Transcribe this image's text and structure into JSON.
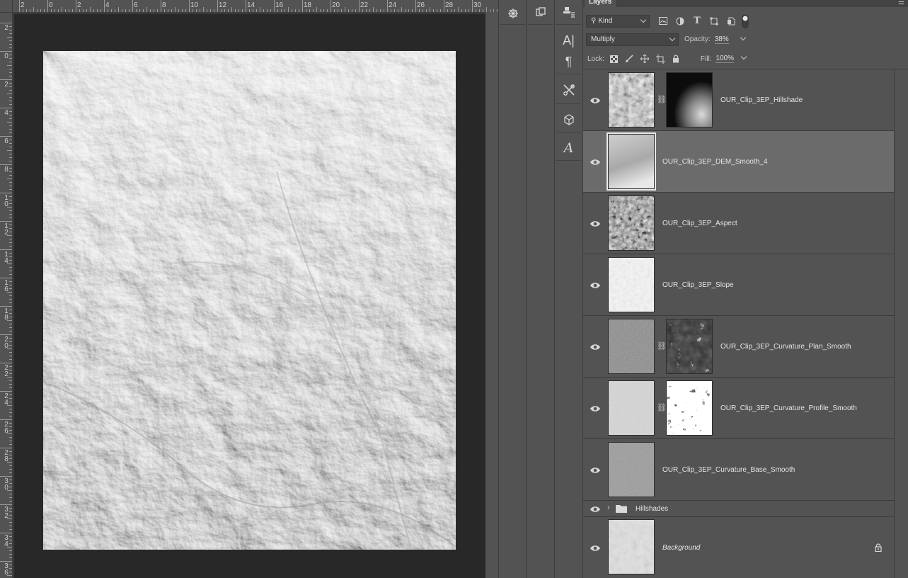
{
  "rulers": {
    "top_labels": [
      "2",
      "0",
      "2",
      "4",
      "6",
      "8",
      "10",
      "12",
      "14",
      "16",
      "18",
      "20",
      "22",
      "24",
      "26",
      "28",
      "30"
    ],
    "left_labels": [
      "2",
      "0",
      "2",
      "4",
      "6",
      "8",
      "10",
      "12",
      "14",
      "16",
      "18",
      "20",
      "22",
      "24",
      "26",
      "28",
      "30",
      "32",
      "34",
      "36"
    ]
  },
  "dock": {
    "strip_a_icons": [
      "navigator-wheel-icon"
    ],
    "strip_b_icons": [
      "layer-comps-icon"
    ],
    "strip_c_icons": [
      "clone-source-icon",
      "character-icon",
      "paragraph-icon",
      "tool-presets-icon",
      "3d-icon",
      "glyphs-icon"
    ],
    "character_glyph": "A|",
    "paragraph_glyph": "¶",
    "glyphs_glyph": "A"
  },
  "layers_panel": {
    "tab_label": "Layers",
    "filter": {
      "kind_label": "Kind",
      "filter_icons": [
        "image-filter-icon",
        "adjustment-filter-icon",
        "type-filter-icon",
        "shape-filter-icon",
        "smart-object-filter-icon"
      ],
      "type_glyph": "T"
    },
    "blend_mode": "Multiply",
    "opacity_label": "Opacity:",
    "opacity_value": "38%",
    "lock_label": "Lock:",
    "fill_label": "Fill:",
    "fill_value": "100%",
    "layers": [
      {
        "name": "OUR_Clip_3EP_Hillshade",
        "has_mask": true,
        "selected": false,
        "thumb": "hillshade",
        "mask": "dark"
      },
      {
        "name": "OUR_Clip_3EP_DEM_Smooth_4",
        "has_mask": false,
        "selected": true,
        "thumb": "dem"
      },
      {
        "name": "OUR_Clip_3EP_Aspect",
        "has_mask": false,
        "selected": false,
        "thumb": "aspect"
      },
      {
        "name": "OUR_Clip_3EP_Slope",
        "has_mask": false,
        "selected": false,
        "thumb": "slope"
      },
      {
        "name": "OUR_Clip_3EP_Curvature_Plan_Smooth",
        "has_mask": true,
        "selected": false,
        "thumb": "curvature",
        "mask": "plan"
      },
      {
        "name": "OUR_Clip_3EP_Curvature_Profile_Smooth",
        "has_mask": true,
        "selected": false,
        "thumb": "light",
        "mask": "profile"
      },
      {
        "name": "OUR_Clip_3EP_Curvature_Base_Smooth",
        "has_mask": false,
        "selected": false,
        "thumb": "curvature"
      }
    ],
    "group": {
      "name": "Hillshades"
    },
    "background_layer": {
      "name": "Background",
      "locked": true
    }
  }
}
